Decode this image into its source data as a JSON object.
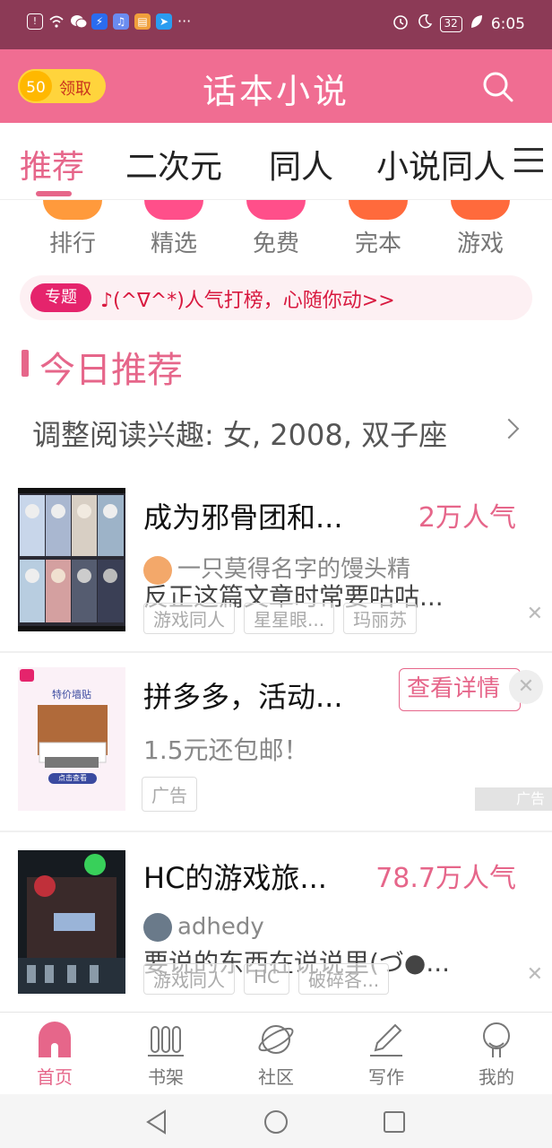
{
  "status_bar": {
    "time": "6:05",
    "battery": "32"
  },
  "header": {
    "title": "话本小说",
    "coins": "50",
    "claim_label": "领取"
  },
  "tabs": [
    {
      "label": "推荐",
      "active": true
    },
    {
      "label": "二次元",
      "active": false
    },
    {
      "label": "同人",
      "active": false
    },
    {
      "label": "小说同人",
      "active": false
    }
  ],
  "categories": [
    {
      "label": "排行",
      "color": "#ff9a3c"
    },
    {
      "label": "精选",
      "color": "#ff4f8a"
    },
    {
      "label": "免费",
      "color": "#ff4f8a"
    },
    {
      "label": "完本",
      "color": "#ff6a3c"
    },
    {
      "label": "游戏",
      "color": "#ff6a3c"
    }
  ],
  "topic": {
    "tag": "专题",
    "text": "♪(^∇^*)人气打榜，心随你动>>"
  },
  "section": {
    "title": "今日推荐"
  },
  "interest": {
    "text": "调整阅读兴趣: 女, 2008, 双子座"
  },
  "cards": [
    {
      "title": "成为邪骨团和...",
      "popularity": "2万人气",
      "author": "一只莫得名字的馒头精",
      "desc": "反正这篇文章时常要咕咕...",
      "tags": [
        "游戏同人",
        "星星眼...",
        "玛丽苏"
      ]
    },
    {
      "title": "HC的游戏旅...",
      "popularity": "78.7万人气",
      "author": "adhedy",
      "desc": "要说的东西在说说里(づ●...",
      "tags": [
        "游戏同人",
        "HC",
        "破碎各..."
      ]
    }
  ],
  "ad": {
    "title": "拼多多，活动...",
    "subtitle": "1.5元还包邮！",
    "tag": "广告",
    "button": "查看详情",
    "corner": "广告",
    "poster_title": "特价墙贴",
    "poster_cta": "点击查看"
  },
  "bottom_nav": [
    {
      "label": "首页",
      "icon": "home-icon",
      "active": true
    },
    {
      "label": "书架",
      "icon": "bookshelf-icon",
      "active": false
    },
    {
      "label": "社区",
      "icon": "planet-icon",
      "active": false
    },
    {
      "label": "写作",
      "icon": "pencil-icon",
      "active": false
    },
    {
      "label": "我的",
      "icon": "profile-icon",
      "active": false
    }
  ],
  "colors": {
    "status_bar": "#8c3a56",
    "header": "#f06d92",
    "accent": "#e6668a",
    "topic_red": "#d8193f"
  }
}
